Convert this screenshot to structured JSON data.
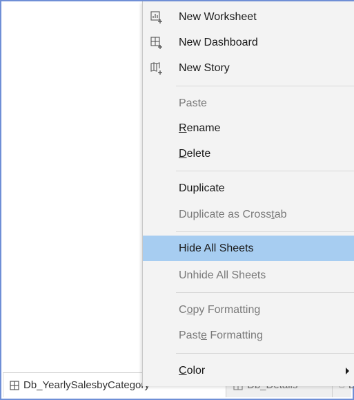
{
  "tabs": [
    {
      "label": "Db_YearlySalesbyCategory",
      "icon": "dashboard-icon"
    },
    {
      "label": "Db_Details",
      "icon": "dashboard-icon"
    },
    {
      "label": "Db",
      "icon": "dashboard-icon"
    }
  ],
  "menu": {
    "new_worksheet": "New Worksheet",
    "new_dashboard": "New Dashboard",
    "new_story": "New Story",
    "paste": "Paste",
    "rename": {
      "accel": "R",
      "rest": "ename"
    },
    "delete": {
      "accel": "D",
      "rest": "elete"
    },
    "duplicate": "Duplicate",
    "duplicate_crosstab": {
      "pre": "Duplicate as Cross",
      "accel": "t",
      "post": "ab"
    },
    "hide_all": "Hide All Sheets",
    "unhide_all": "Unhide All Sheets",
    "copy_formatting": {
      "pre": "C",
      "accel": "o",
      "post": "py Formatting"
    },
    "paste_formatting": {
      "pre": "Past",
      "accel": "e",
      "post": " Formatting"
    },
    "color": {
      "accel": "C",
      "rest": "olor"
    }
  },
  "colors": {
    "highlight": "#a7cdf1",
    "frame_border": "#6f8fd6",
    "menu_bg": "#f3f3f3"
  }
}
